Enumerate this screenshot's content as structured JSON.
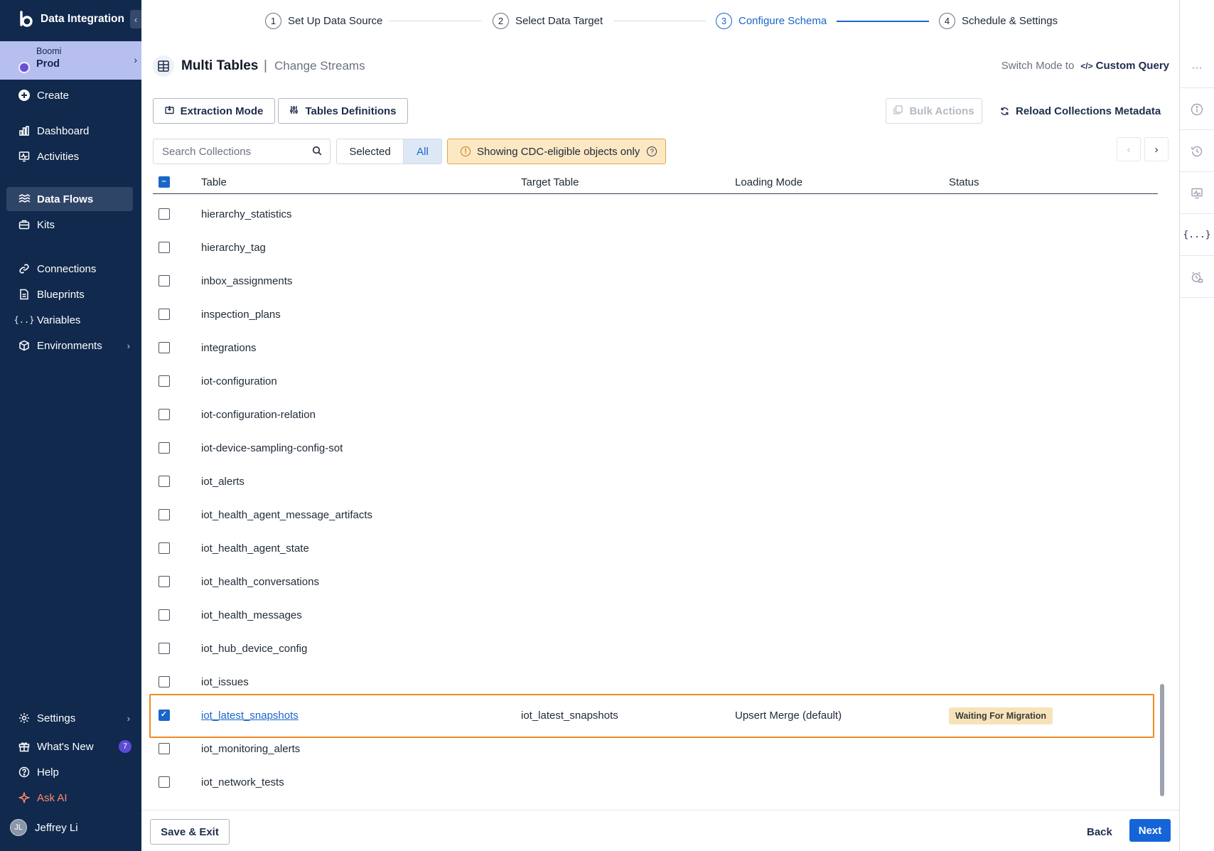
{
  "sidebar": {
    "brand": "Data Integration",
    "collapse_icon": "chevron-left-icon",
    "environment": {
      "org": "Boomi",
      "name": "Prod"
    },
    "nav": {
      "create": "Create",
      "dashboard": "Dashboard",
      "activities": "Activities",
      "data_flows": "Data Flows",
      "kits": "Kits",
      "connections": "Connections",
      "blueprints": "Blueprints",
      "variables": "Variables",
      "environments": "Environments",
      "settings": "Settings",
      "whats_new": "What's New",
      "whats_new_count": "7",
      "help": "Help",
      "ask_ai": "Ask AI"
    },
    "user": {
      "initials": "JL",
      "name": "Jeffrey Li"
    }
  },
  "stepper": {
    "steps": [
      {
        "num": "1",
        "label": "Set Up Data Source"
      },
      {
        "num": "2",
        "label": "Select Data Target"
      },
      {
        "num": "3",
        "label": "Configure Schema"
      },
      {
        "num": "4",
        "label": "Schedule & Settings"
      }
    ],
    "active_step": 3
  },
  "header": {
    "title": "Multi Tables",
    "separator": "|",
    "subtitle": "Change Streams",
    "switch_mode_label": "Switch Mode to",
    "custom_query_label": "Custom Query"
  },
  "toolbar": {
    "extraction_mode": "Extraction Mode",
    "tables_definitions": "Tables Definitions",
    "bulk_actions": "Bulk Actions",
    "reload": "Reload Collections Metadata"
  },
  "filters": {
    "search_placeholder": "Search Collections",
    "search_value": "",
    "selected_label": "Selected",
    "all_label": "All",
    "active_filter": "All",
    "cdc_notice": "Showing CDC-eligible objects only"
  },
  "table": {
    "columns": {
      "table": "Table",
      "target": "Target Table",
      "loading": "Loading Mode",
      "status": "Status"
    },
    "rows": [
      {
        "table": "hierarchy_statistics",
        "checked": false
      },
      {
        "table": "hierarchy_tag",
        "checked": false
      },
      {
        "table": "inbox_assignments",
        "checked": false
      },
      {
        "table": "inspection_plans",
        "checked": false
      },
      {
        "table": "integrations",
        "checked": false
      },
      {
        "table": "iot-configuration",
        "checked": false
      },
      {
        "table": "iot-configuration-relation",
        "checked": false
      },
      {
        "table": "iot-device-sampling-config-sot",
        "checked": false
      },
      {
        "table": "iot_alerts",
        "checked": false
      },
      {
        "table": "iot_health_agent_message_artifacts",
        "checked": false
      },
      {
        "table": "iot_health_agent_state",
        "checked": false
      },
      {
        "table": "iot_health_conversations",
        "checked": false
      },
      {
        "table": "iot_health_messages",
        "checked": false
      },
      {
        "table": "iot_hub_device_config",
        "checked": false
      },
      {
        "table": "iot_issues",
        "checked": false
      },
      {
        "table": "iot_latest_snapshots",
        "checked": true,
        "target": "iot_latest_snapshots",
        "loading": "Upsert Merge (default)",
        "status": "Waiting For Migration"
      },
      {
        "table": "iot_monitoring_alerts",
        "checked": false
      },
      {
        "table": "iot_network_tests",
        "checked": false
      }
    ]
  },
  "footer": {
    "save_exit": "Save & Exit",
    "back": "Back",
    "next": "Next"
  },
  "colors": {
    "sidebar_bg": "#10294d",
    "accent": "#1a66c9",
    "highlight": "#f08a24",
    "status_badge": "#f7e3b9",
    "cdc_banner": "#fde8c4"
  }
}
